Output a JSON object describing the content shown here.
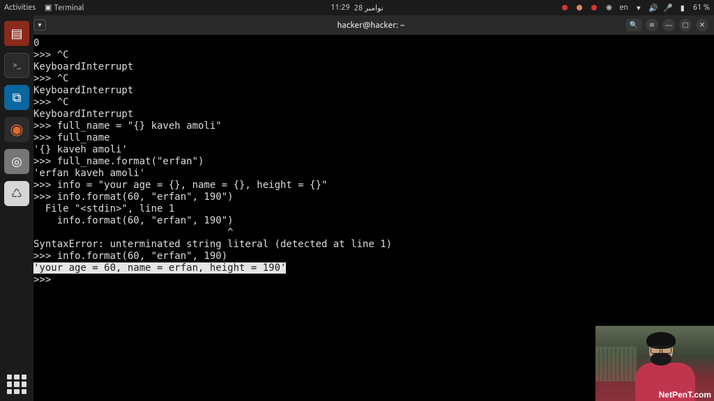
{
  "topbar": {
    "activities": "Activities",
    "app_indicator": "Terminal",
    "clock_time": "11:29",
    "clock_date": "نوامبر 28",
    "lang": "en",
    "battery": "61 %"
  },
  "terminal": {
    "title": "hacker@hacker: ~",
    "lines": [
      "0",
      ">>> ^C",
      "KeyboardInterrupt",
      ">>> ^C",
      "KeyboardInterrupt",
      ">>> ^C",
      "KeyboardInterrupt",
      ">>> full_name = \"{} kaveh amoli\"",
      ">>> full_name",
      "'{} kaveh amoli'",
      ">>> full_name.format(\"erfan\")",
      "'erfan kaveh amoli'",
      ">>> info = \"your age = {}, name = {}, height = {}\"",
      ">>> info.format(60, \"erfan\", 190\")",
      "  File \"<stdin>\", line 1",
      "    info.format(60, \"erfan\", 190\")",
      "                                 ^",
      "SyntaxError: unterminated string literal (detected at line 1)",
      ">>> info.format(60, \"erfan\", 190)"
    ],
    "selected_line": "'your age = 60, name = erfan, height = 190'",
    "final_prompt": ">>> "
  },
  "cam": {
    "watermark": "NetPenT.com"
  },
  "dock": {
    "items": [
      {
        "name": "libreoffice-impress",
        "glyph": "▤"
      },
      {
        "name": "terminal",
        "glyph": ">_"
      },
      {
        "name": "vscode",
        "glyph": "⧉"
      },
      {
        "name": "firefox",
        "glyph": "●"
      },
      {
        "name": "disks",
        "glyph": "◉"
      },
      {
        "name": "trash",
        "glyph": "♺"
      }
    ]
  }
}
